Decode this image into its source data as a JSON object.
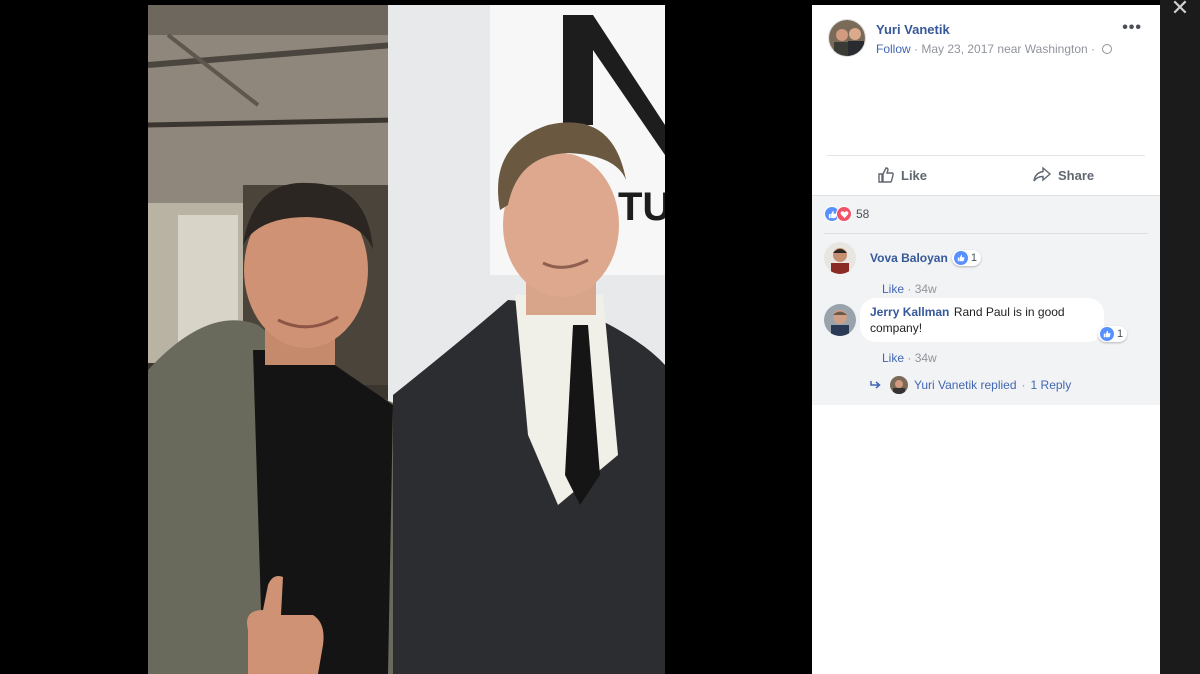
{
  "post": {
    "author": "Yuri Vanetik",
    "follow": "Follow",
    "meta": "· May 23, 2017 near Washington ·",
    "options_label": "•••"
  },
  "actions": {
    "like": "Like",
    "share": "Share"
  },
  "reactions": {
    "count": "58",
    "types": [
      "like",
      "love"
    ]
  },
  "comments": [
    {
      "name": "Vova Baloyan",
      "text": "",
      "likes": "1",
      "like_label": "Like",
      "age": "34w"
    },
    {
      "name": "Jerry Kallman",
      "text": "Rand Paul is in good company!",
      "likes": "1",
      "like_label": "Like",
      "age": "34w"
    }
  ],
  "reply": {
    "text": "Yuri Vanetik replied",
    "sep": "·",
    "count": "1 Reply"
  },
  "photo_sign_text": "TUR",
  "colors": {
    "link": "#365899",
    "accent": "#4267b2",
    "like_blue": "#5890ff",
    "love_red": "#f25268",
    "comment_bg": "#f2f3f5"
  },
  "icons": [
    "close-icon",
    "globe-icon",
    "more-options-icon",
    "thumbs-up-icon",
    "share-arrow-icon",
    "like-reaction-icon",
    "love-reaction-icon",
    "reply-arrow-icon"
  ]
}
